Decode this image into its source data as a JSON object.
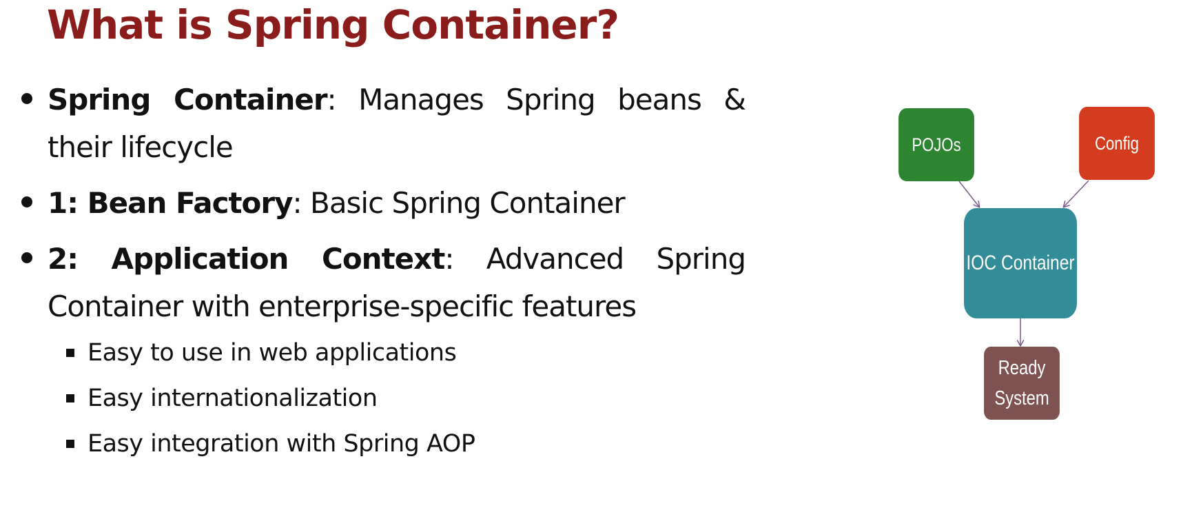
{
  "title": "What is Spring Container?",
  "bullets": [
    {
      "strong": "Spring Container",
      "rest": ": Manages Spring beans & their lifecycle"
    },
    {
      "strong": "1: Bean Factory",
      "rest": ": Basic Spring Container"
    },
    {
      "strong": "2: Application Context",
      "rest": ": Advanced Spring Container with enterprise-specific features"
    }
  ],
  "sub_bullets": [
    "Easy to use in web applications",
    "Easy internationalization",
    "Easy integration with Spring AOP"
  ],
  "diagram": {
    "nodes": {
      "pojos": {
        "label": "POJOs",
        "color": "#2e8531"
      },
      "config": {
        "label": "Config",
        "color": "#d33c1f"
      },
      "ioc": {
        "label": "IOC Container",
        "color": "#338d98"
      },
      "ready": {
        "label": "Ready\nSystem",
        "color": "#7f5252"
      }
    },
    "arrow_color": "#7a5a86"
  }
}
